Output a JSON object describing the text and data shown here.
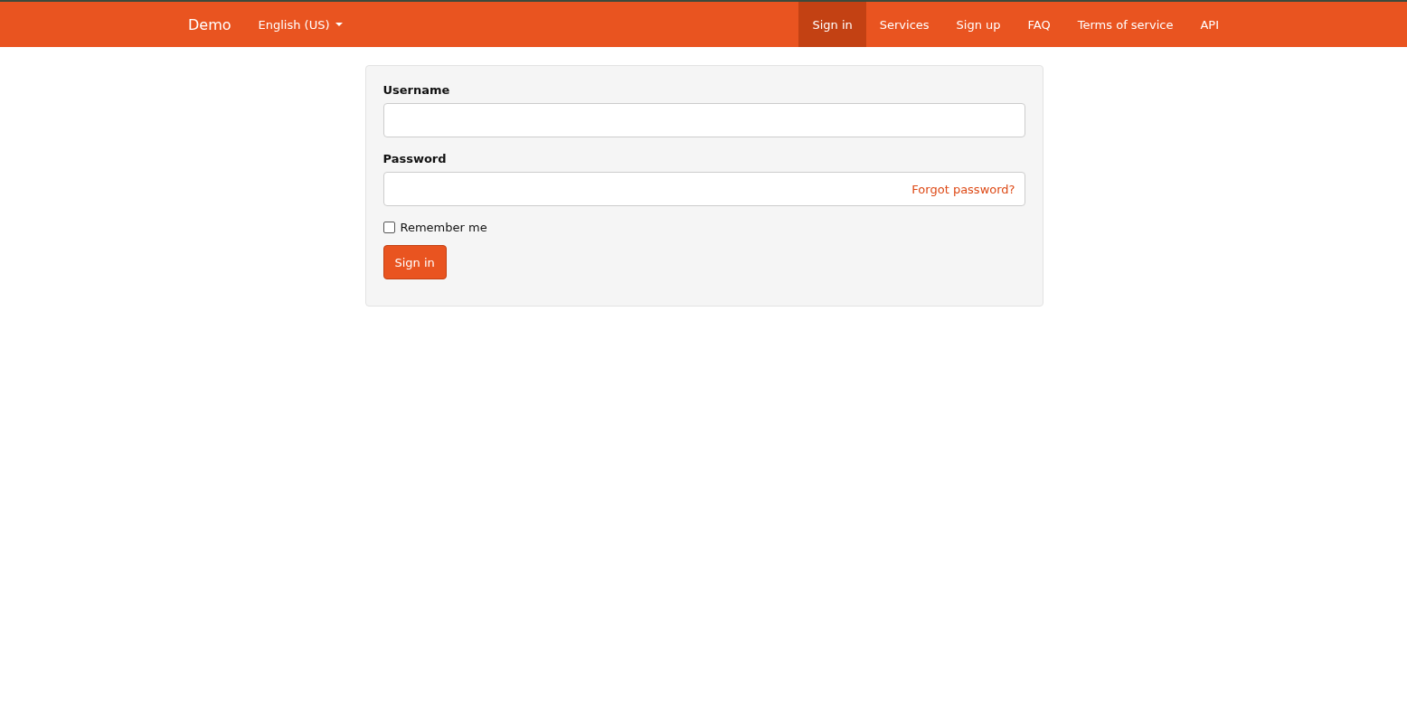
{
  "navbar": {
    "brand": "Demo",
    "language": "English (US)",
    "items": [
      {
        "label": "Sign in",
        "selected": true
      },
      {
        "label": "Services",
        "selected": false
      },
      {
        "label": "Sign up",
        "selected": false
      },
      {
        "label": "FAQ",
        "selected": false
      },
      {
        "label": "Terms of service",
        "selected": false
      },
      {
        "label": "API",
        "selected": false
      }
    ]
  },
  "form": {
    "username_label": "Username",
    "password_label": "Password",
    "forgot_link": "Forgot password?",
    "remember": {
      "label": "Remember me",
      "checked": false
    },
    "submit": "Sign in"
  }
}
